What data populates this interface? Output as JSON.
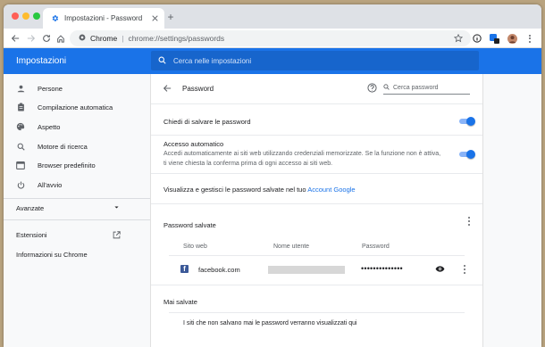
{
  "browser": {
    "tab_title": "Impostazioni - Password",
    "new_tab_symbol": "+",
    "address": {
      "scheme_label": "Chrome",
      "separator": "|",
      "url": "chrome://settings/passwords"
    },
    "extension_badge": "3"
  },
  "settings": {
    "title": "Impostazioni",
    "search_placeholder": "Cerca nelle impostazioni"
  },
  "sidebar": {
    "items": [
      {
        "label": "Persone",
        "icon": "person-icon"
      },
      {
        "label": "Compilazione automatica",
        "icon": "clipboard-icon"
      },
      {
        "label": "Aspetto",
        "icon": "palette-icon"
      },
      {
        "label": "Motore di ricerca",
        "icon": "search-icon"
      },
      {
        "label": "Browser predefinito",
        "icon": "browser-icon"
      },
      {
        "label": "All'avvio",
        "icon": "power-icon"
      }
    ],
    "advanced_label": "Avanzate",
    "extensions_label": "Estensioni",
    "about_label": "Informazioni su Chrome"
  },
  "passwords_page": {
    "title": "Password",
    "search_placeholder": "Cerca password",
    "offer_to_save_label": "Chiedi di salvare le password",
    "offer_to_save_enabled": true,
    "auto_signin_title": "Accesso automatico",
    "auto_signin_desc_1": "Accedi automaticamente ai siti web utilizzando credenziali memorizzate. Se la funzione non è attiva,",
    "auto_signin_desc_2": "ti viene chiesta la conferma prima di ogni accesso ai siti web.",
    "auto_signin_enabled": true,
    "manage_text": "Visualizza e gestisci le password salvate nel tuo",
    "manage_link": "Account Google",
    "saved_title": "Password salvate",
    "columns": [
      "Sito web",
      "Nome utente",
      "Password"
    ],
    "entries": [
      {
        "site": "facebook.com",
        "username": "",
        "password": "••••••••••••••"
      }
    ],
    "never_saved_title": "Mai salvate",
    "never_saved_desc": "I siti che non salvano mai le password verranno visualizzati qui"
  },
  "colors": {
    "accent": "#1a73e8",
    "header_search": "#1765cc",
    "toggle_track": "#8ab4f8"
  }
}
